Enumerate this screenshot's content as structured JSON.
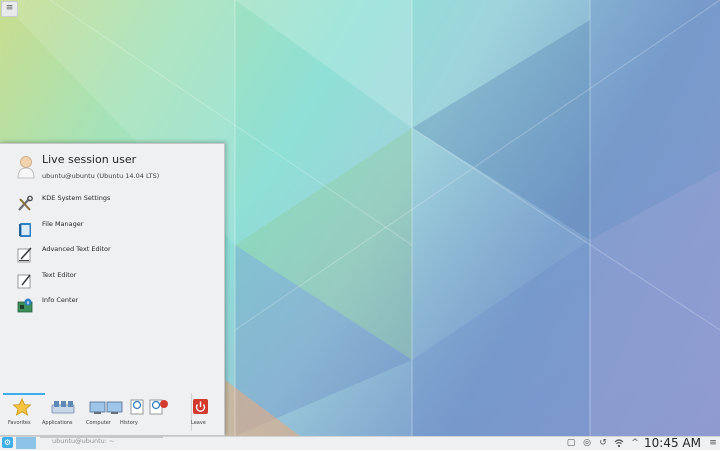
{
  "desktop": {
    "corner_button_icon": "hamburger-icon"
  },
  "launcher": {
    "user": {
      "name": "Live session user",
      "host": "ubuntu@ubuntu (Ubuntu 14.04 LTS)"
    },
    "favorites": [
      {
        "label": "KDE System Settings",
        "icon": "tools-icon"
      },
      {
        "label": "File Manager",
        "icon": "folder-icon"
      },
      {
        "label": "Advanced Text Editor",
        "icon": "advanced-editor-icon"
      },
      {
        "label": "Text Editor",
        "icon": "text-editor-icon"
      },
      {
        "label": "Info Center",
        "icon": "info-icon"
      }
    ],
    "tabs": [
      {
        "label": "Favorites",
        "icon": "star-icon",
        "active": true
      },
      {
        "label": "Applications",
        "icon": "applications-icon",
        "active": false
      },
      {
        "label": "Computer",
        "icon": "computer-icon",
        "active": false
      },
      {
        "label": "History",
        "icon": "history-icon",
        "active": false
      },
      {
        "label": "Leave",
        "icon": "power-icon",
        "active": false
      }
    ]
  },
  "panel": {
    "task": {
      "label": "ubuntu@ubuntu: ~"
    },
    "tray_icons": [
      "clipboard-icon",
      "power-management-icon",
      "device-notifier-icon",
      "wifi-icon",
      "expand-tray-icon"
    ],
    "clock": "10:45 AM",
    "colors": {
      "accent": "#3daee9",
      "panel_bg": "#eff0f1"
    }
  }
}
